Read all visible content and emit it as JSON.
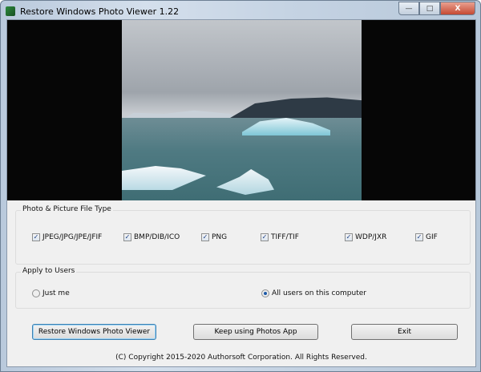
{
  "window": {
    "title": "Restore Windows Photo Viewer 1.22",
    "minimize_label": "—",
    "maximize_label": "□",
    "close_label": "X"
  },
  "file_types": {
    "legend": "Photo & Picture File Type",
    "items": [
      {
        "label": "JPEG/JPG/JPE/JFIF",
        "checked": true
      },
      {
        "label": "BMP/DIB/ICO",
        "checked": true
      },
      {
        "label": "PNG",
        "checked": true
      },
      {
        "label": "TIFF/TIF",
        "checked": true
      },
      {
        "label": "WDP/JXR",
        "checked": true
      },
      {
        "label": "GIF",
        "checked": true
      }
    ]
  },
  "users": {
    "legend": "Apply to Users",
    "options": [
      {
        "label": "Just me",
        "selected": false
      },
      {
        "label": "All users on this computer",
        "selected": true
      }
    ]
  },
  "buttons": {
    "restore": "Restore Windows Photo Viewer",
    "keep": "Keep using Photos App",
    "exit": "Exit"
  },
  "check_glyph": "✓",
  "copyright": "(C) Copyright 2015-2020 Authorsoft Corporation. All Rights Reserved."
}
